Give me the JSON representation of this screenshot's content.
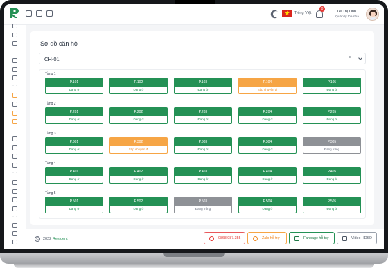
{
  "header": {
    "language": "Tiếng Việt",
    "notifications_count": "0",
    "user_name": "Lê Thị Linh",
    "user_role": "Quản lý tòa nhà"
  },
  "page": {
    "title": "Sơ đồ căn hộ",
    "building_select": "CH-01",
    "clear_symbol": "×"
  },
  "floors": [
    {
      "label": "Tầng 1",
      "rooms": [
        {
          "name": "P.101",
          "status": "Đang ở",
          "state": "occupied"
        },
        {
          "name": "P.102",
          "status": "Đang ở",
          "state": "occupied"
        },
        {
          "name": "P.103",
          "status": "Đang ở",
          "state": "occupied"
        },
        {
          "name": "P.104",
          "status": "Sắp chuyển đi",
          "state": "moving"
        },
        {
          "name": "P.105",
          "status": "Đang ở",
          "state": "occupied"
        }
      ]
    },
    {
      "label": "Tầng 2",
      "rooms": [
        {
          "name": "P.201",
          "status": "Đang ở",
          "state": "occupied"
        },
        {
          "name": "P.202",
          "status": "Đang ở",
          "state": "occupied"
        },
        {
          "name": "P.203",
          "status": "Đang ở",
          "state": "occupied"
        },
        {
          "name": "P.204",
          "status": "Đang ở",
          "state": "occupied"
        },
        {
          "name": "P.205",
          "status": "Đang ở",
          "state": "occupied"
        }
      ]
    },
    {
      "label": "Tầng 3",
      "rooms": [
        {
          "name": "P.301",
          "status": "Đang ở",
          "state": "occupied"
        },
        {
          "name": "P.302",
          "status": "Sắp chuyển đi",
          "state": "moving"
        },
        {
          "name": "P.303",
          "status": "Đang ở",
          "state": "occupied"
        },
        {
          "name": "P.304",
          "status": "Đang ở",
          "state": "occupied"
        },
        {
          "name": "P.305",
          "status": "Đang trống",
          "state": "vacant"
        }
      ]
    },
    {
      "label": "Tầng 4",
      "rooms": [
        {
          "name": "P.401",
          "status": "Đang ở",
          "state": "occupied"
        },
        {
          "name": "P.402",
          "status": "Đang ở",
          "state": "occupied"
        },
        {
          "name": "P.403",
          "status": "Đang ở",
          "state": "occupied"
        },
        {
          "name": "P.404",
          "status": "Đang ở",
          "state": "occupied"
        },
        {
          "name": "P.405",
          "status": "Đang ở",
          "state": "occupied"
        }
      ]
    },
    {
      "label": "Tầng 5",
      "rooms": [
        {
          "name": "P.501",
          "status": "Đang ở",
          "state": "occupied"
        },
        {
          "name": "P.502",
          "status": "Đang ở",
          "state": "occupied"
        },
        {
          "name": "P.503",
          "status": "Đang trống",
          "state": "vacant"
        },
        {
          "name": "P.504",
          "status": "Đang ở",
          "state": "occupied"
        },
        {
          "name": "P.505",
          "status": "Đang ở",
          "state": "occupied"
        }
      ]
    }
  ],
  "footer": {
    "copyright_symbol": "C",
    "year": "2022",
    "brand": "Resident",
    "phone": "0868.987.355",
    "zalo": "Zalo hỗ trợ",
    "fanpage": "Fanpage hỗ trợ",
    "video": "Video HDSD"
  },
  "colors": {
    "occupied": "#249155",
    "moving": "#f6a545",
    "vacant": "#8e9196",
    "brand": "#249155"
  },
  "icons": {
    "topbar": [
      "grid-icon",
      "window-icon",
      "checklist-icon",
      "moon-icon",
      "vietnam-flag-icon",
      "bell-icon"
    ],
    "sidebar": [
      "dashboard-icon",
      "home-icon",
      "task-icon",
      "building-icon",
      "apartment-icon",
      "resident-icon",
      "report-icon",
      "chart-icon",
      "service-icon",
      "request-icon",
      "tool-icon",
      "edit-icon",
      "car-icon",
      "file-icon",
      "document-icon",
      "contract-icon",
      "invoice-icon",
      "settings-icon",
      "security-icon",
      "monitor-icon"
    ]
  }
}
